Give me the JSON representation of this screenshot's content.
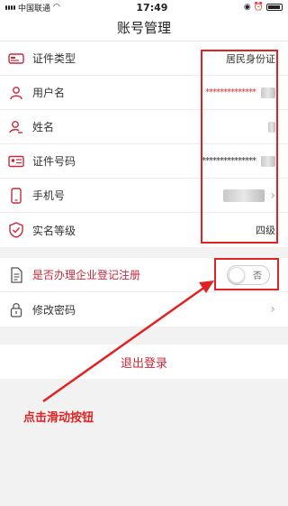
{
  "status": {
    "carrier": "中国联通",
    "time": "17:49"
  },
  "nav": {
    "title": "账号管理"
  },
  "info_rows": [
    {
      "label": "证件类型",
      "value": "居民身份证"
    },
    {
      "label": "用户名",
      "value": "**************"
    },
    {
      "label": "姓名",
      "value": ""
    },
    {
      "label": "证件号码",
      "value": "***************"
    },
    {
      "label": "手机号",
      "value": ""
    },
    {
      "label": "实名等级",
      "value": "四级"
    }
  ],
  "enterprise": {
    "label": "是否办理企业登记注册",
    "toggle_text": "否",
    "toggle_on": false
  },
  "password": {
    "label": "修改密码"
  },
  "logout": {
    "label": "退出登录"
  },
  "annotation": {
    "text": "点击滑动按钮",
    "color": "#e02222"
  },
  "colors": {
    "accent": "#c8283a"
  }
}
